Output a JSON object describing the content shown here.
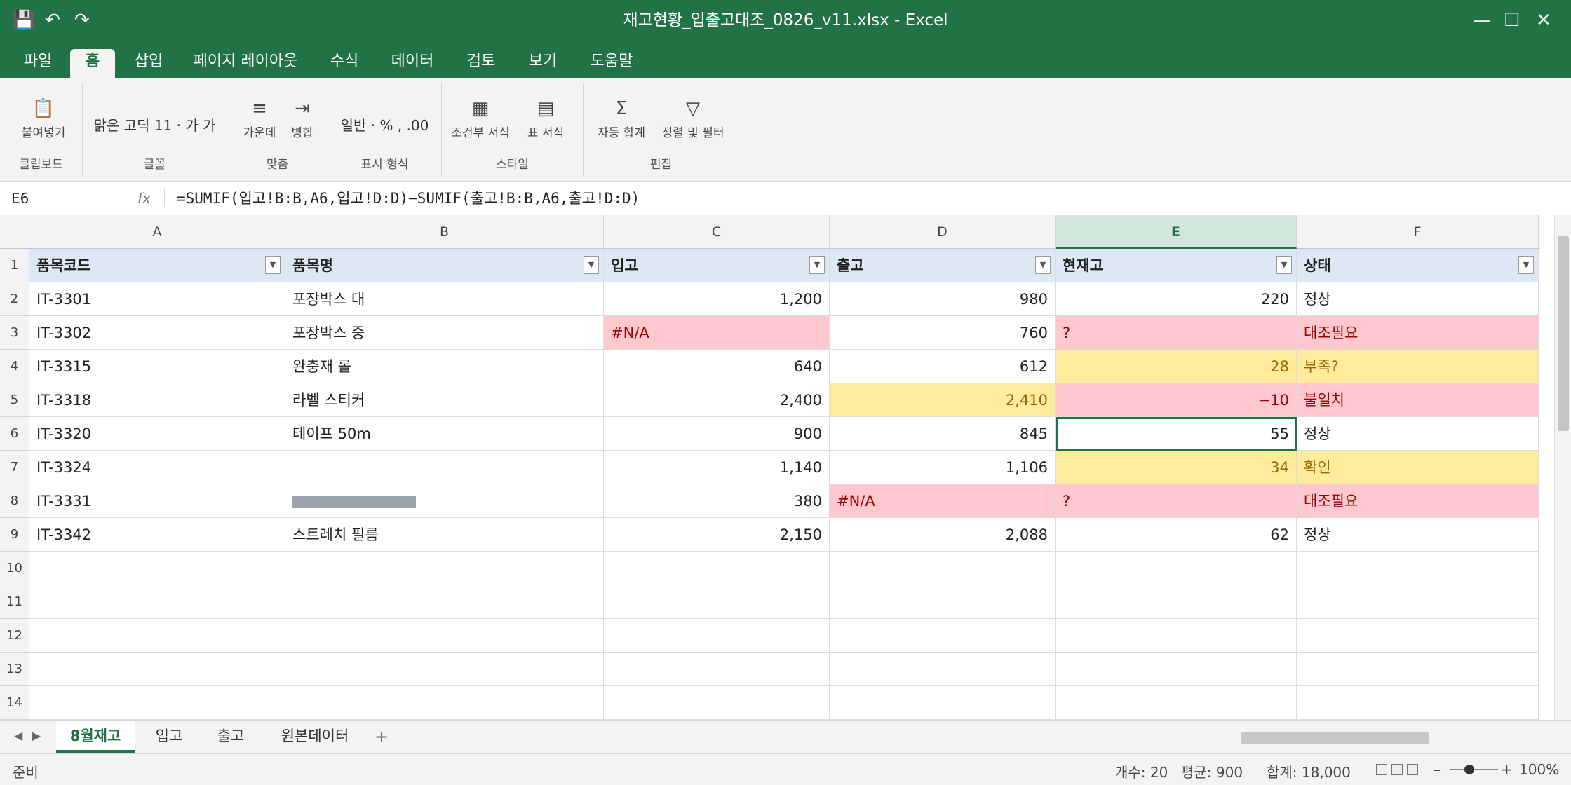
{
  "title_bar": {
    "title": "재고현황_입출고대조_0826_v11.xlsx - Excel"
  },
  "ribbon_tabs": [
    "파일",
    "홈",
    "삽입",
    "페이지 레이아웃",
    "수식",
    "데이터",
    "검토",
    "보기",
    "도움말"
  ],
  "active_tab": "홈",
  "ribbon": {
    "clipboard": {
      "paste": "붙여넣기",
      "group": "클립보드"
    },
    "font": {
      "text": "맑은 고딕 11 · 가 가",
      "group": "글꼴"
    },
    "align": {
      "center": "가운데",
      "merge": "병합",
      "group": "맞춤"
    },
    "number": {
      "text": "일반 · % , .00",
      "group": "표시 형식"
    },
    "styles": {
      "cond": "조건부 서식",
      "table": "표 서식",
      "group": "스타일"
    },
    "edit": {
      "autosum": "자동 합계",
      "sortfilter": "정렬 및 필터",
      "group": "편집"
    }
  },
  "formula_bar": {
    "name_box": "E6",
    "fx": "fx",
    "formula": "=SUMIF(입고!B:B,A6,입고!D:D)−SUMIF(출고!B:B,A6,출고!D:D)"
  },
  "columns": [
    "A",
    "B",
    "C",
    "D",
    "E",
    "F"
  ],
  "selected_column": "E",
  "row_numbers": [
    "1",
    "2",
    "3",
    "4",
    "5",
    "6",
    "7",
    "8",
    "9",
    "10",
    "11",
    "12",
    "13",
    "14"
  ],
  "table": {
    "headers": [
      "품목코드",
      "품목명",
      "입고",
      "출고",
      "현재고",
      "상태"
    ],
    "rows": [
      [
        "IT-3301",
        "포장박스 대",
        "1,200",
        "980",
        "220",
        "정상"
      ],
      [
        "IT-3302",
        "포장박스 중",
        "#N/A",
        "760",
        "?",
        "대조필요"
      ],
      [
        "IT-3315",
        "완충재 롤",
        "640",
        "612",
        "28",
        "부족?"
      ],
      [
        "IT-3318",
        "라벨 스티커",
        "2,400",
        "2,410",
        "−10",
        "불일치"
      ],
      [
        "IT-3320",
        "테이프 50m",
        "900",
        "845",
        "55",
        "정상"
      ],
      [
        "IT-3324",
        "",
        "1,140",
        "1,106",
        "34",
        "확인"
      ],
      [
        "IT-3331",
        "",
        "380",
        "#N/A",
        "?",
        "대조필요"
      ],
      [
        "IT-3342",
        "스트레치 필름",
        "2,150",
        "2,088",
        "62",
        "정상"
      ]
    ],
    "active_cell": "E6"
  },
  "sheets": [
    "8월재고",
    "입고",
    "출고",
    "원본데이터"
  ],
  "active_sheet": "8월재고",
  "status": {
    "ready": "준비",
    "count": "개수: 20",
    "average": "평균: 900",
    "sum": "합계: 18,000",
    "zoom": "100%"
  },
  "colors": {
    "excel_green": "#217346",
    "error_fill": "#ffc7ce",
    "warn_fill": "#ffeb9c"
  }
}
